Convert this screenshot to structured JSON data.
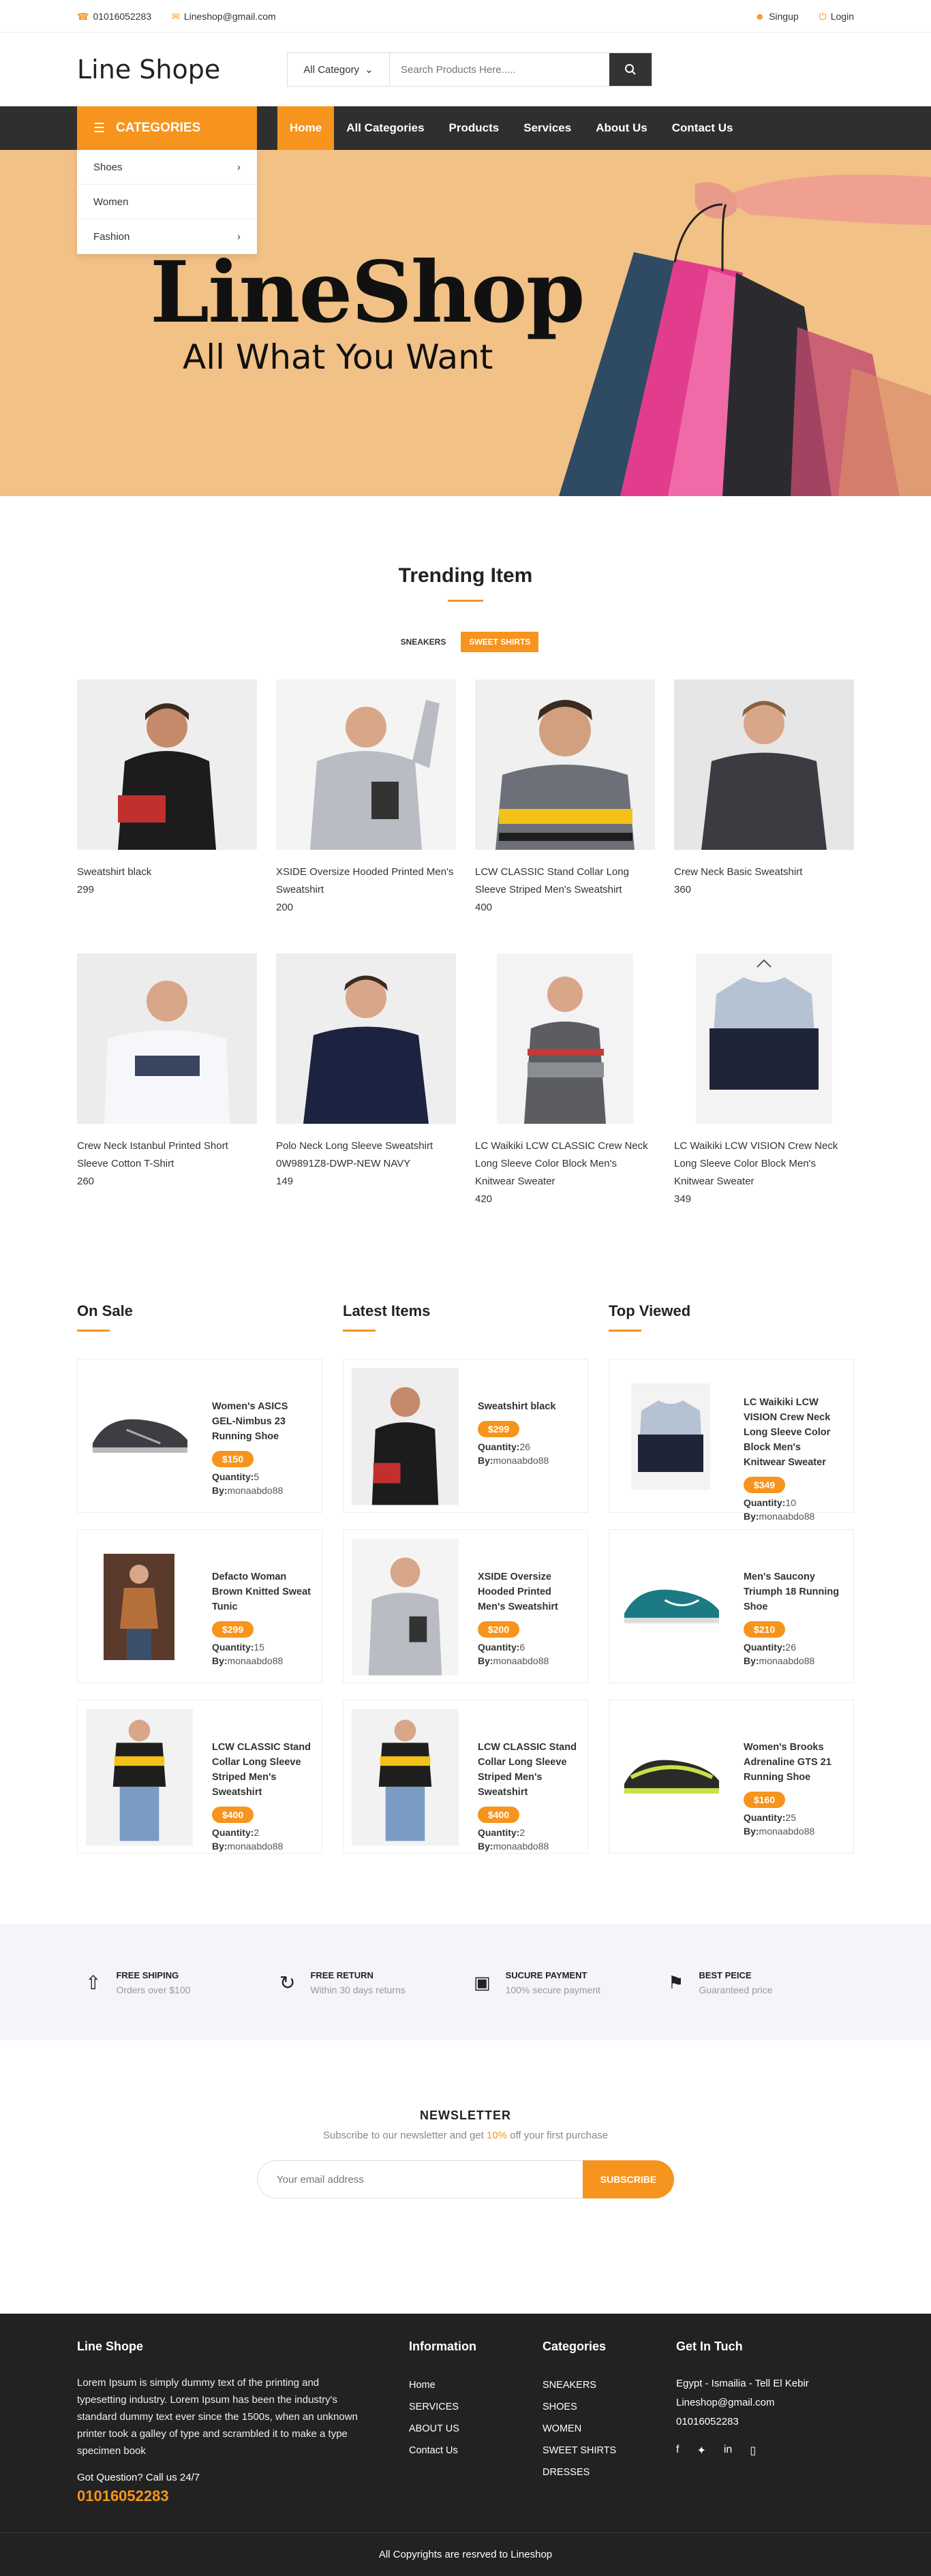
{
  "topbar": {
    "phone": "01016052283",
    "email": "Lineshop@gmail.com",
    "signup": "Singup",
    "login": "Login"
  },
  "header": {
    "logo": "Line Shope",
    "category_select": "All Category",
    "search_placeholder": "Search Products Here....."
  },
  "nav": {
    "categories_label": "CATEGORIES",
    "category_items": [
      {
        "label": "Shoes"
      },
      {
        "label": "Women"
      },
      {
        "label": "Fashion"
      }
    ],
    "menu": [
      {
        "label": "Home"
      },
      {
        "label": "All Categories"
      },
      {
        "label": "Products"
      },
      {
        "label": "Services"
      },
      {
        "label": "About Us"
      },
      {
        "label": "Contact Us"
      }
    ]
  },
  "hero": {
    "title": "LineShop",
    "subtitle": "All What You Want"
  },
  "trending": {
    "title": "Trending Item",
    "tabs": [
      "SNEAKERS",
      "SWEET SHIRTS"
    ],
    "products": [
      {
        "name": "Sweatshirt black",
        "price": "299"
      },
      {
        "name": "XSIDE Oversize Hooded Printed Men's Sweatshirt",
        "price": "200"
      },
      {
        "name": "LCW CLASSIC Stand Collar Long Sleeve Striped Men's Sweatshirt",
        "price": "400"
      },
      {
        "name": "Crew Neck Basic Sweatshirt",
        "price": "360"
      },
      {
        "name": "Crew Neck Istanbul Printed Short Sleeve Cotton T-Shirt",
        "price": "260"
      },
      {
        "name": "Polo Neck Long Sleeve Sweatshirt 0W9891Z8-DWP-NEW NAVY",
        "price": "149"
      },
      {
        "name": "LC Waikiki LCW CLASSIC Crew Neck Long Sleeve Color Block Men's Knitwear Sweater",
        "price": "420"
      },
      {
        "name": "LC Waikiki LCW VISION Crew Neck Long Sleeve Color Block Men's Knitwear Sweater",
        "price": "349"
      }
    ]
  },
  "labels": {
    "quantity": "Quantity:",
    "by": "By:"
  },
  "columns": [
    {
      "title": "On Sale",
      "items": [
        {
          "name": "Women's ASICS GEL-Nimbus 23 Running Shoe",
          "price": "$150",
          "qty": "5",
          "by": "monaabdo88"
        },
        {
          "name": "Defacto Woman Brown Knitted Sweat Tunic",
          "price": "$299",
          "qty": "15",
          "by": "monaabdo88"
        },
        {
          "name": "LCW CLASSIC Stand Collar Long Sleeve Striped Men's Sweatshirt",
          "price": "$400",
          "qty": "2",
          "by": "monaabdo88"
        }
      ]
    },
    {
      "title": "Latest Items",
      "items": [
        {
          "name": "Sweatshirt black",
          "price": "$299",
          "qty": "26",
          "by": "monaabdo88"
        },
        {
          "name": "XSIDE Oversize Hooded Printed Men's Sweatshirt",
          "price": "$200",
          "qty": "6",
          "by": "monaabdo88"
        },
        {
          "name": "LCW CLASSIC Stand Collar Long Sleeve Striped Men's Sweatshirt",
          "price": "$400",
          "qty": "2",
          "by": "monaabdo88"
        }
      ]
    },
    {
      "title": "Top Viewed",
      "items": [
        {
          "name": "LC Waikiki LCW VISION Crew Neck Long Sleeve Color Block Men's Knitwear Sweater",
          "price": "$349",
          "qty": "10",
          "by": "monaabdo88"
        },
        {
          "name": "Men's Saucony Triumph 18 Running Shoe",
          "price": "$210",
          "qty": "26",
          "by": "monaabdo88"
        },
        {
          "name": "Women's Brooks Adrenaline GTS 21 Running Shoe",
          "price": "$160",
          "qty": "25",
          "by": "monaabdo88"
        }
      ]
    }
  ],
  "features": [
    {
      "title": "FREE SHIPING",
      "sub": "Orders over $100",
      "icon": "rocket-icon"
    },
    {
      "title": "FREE RETURN",
      "sub": "Within 30 days returns",
      "icon": "refresh-icon"
    },
    {
      "title": "SUCURE PAYMENT",
      "sub": "100% secure payment",
      "icon": "lock-icon"
    },
    {
      "title": "BEST PEICE",
      "sub": "Guaranteed price",
      "icon": "tag-icon"
    }
  ],
  "newsletter": {
    "title": "NEWSLETTER",
    "text_before": "Subscribe to our newsletter and get ",
    "highlight": "10%",
    "text_after": " off your first purchase",
    "placeholder": "Your email address",
    "button": "SUBSCRIBE"
  },
  "footer": {
    "brand": "Line Shope",
    "about": "Lorem Ipsum is simply dummy text of the printing and typesetting industry. Lorem Ipsum has been the industry's standard dummy text ever since the 1500s, when an unknown printer took a galley of type and scrambled it to make a type specimen book",
    "question": "Got Question? Call us 24/7",
    "phone": "01016052283",
    "info_title": "Information",
    "info_links": [
      "Home",
      "SERVICES",
      "ABOUT US",
      "Contact Us"
    ],
    "cat_title": "Categories",
    "cat_links": [
      "SNEAKERS",
      "SHOES",
      "WOMEN",
      "SWEET SHIRTS",
      "DRESSES"
    ],
    "contact_title": "Get In Tuch",
    "address": "Egypt - Ismailia - Tell El Kebir",
    "email": "Lineshop@gmail.com",
    "tel": "01016052283",
    "copyright": "All Copyrights are resrved to Lineshop"
  },
  "colors": {
    "accent": "#f7941d",
    "dark": "#2f2f2f",
    "hero_bg": "#f2c185"
  }
}
